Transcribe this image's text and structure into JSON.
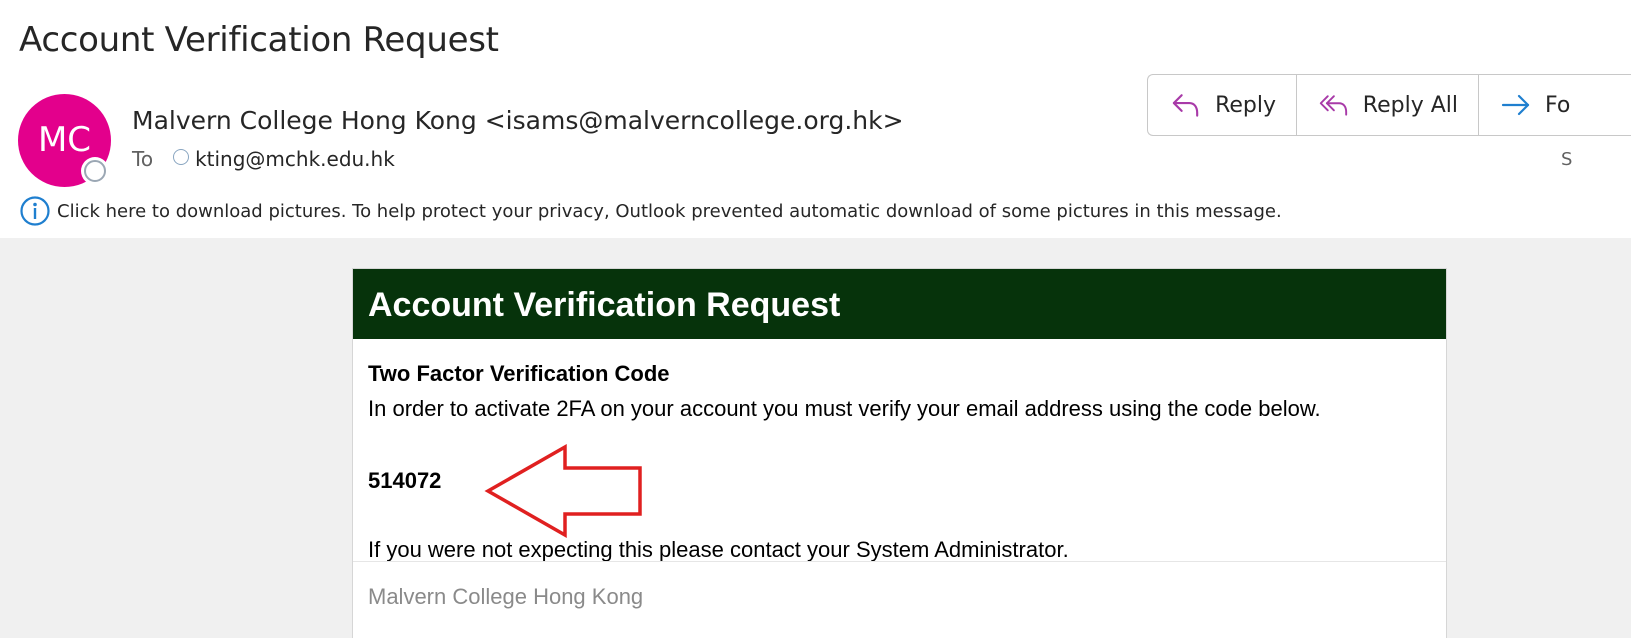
{
  "subject": "Account Verification Request",
  "avatar": {
    "initials": "MC",
    "color": "#e3008c"
  },
  "sender": {
    "display": "Malvern College Hong Kong <isams@malverncollege.org.hk>"
  },
  "recipients": {
    "label": "To",
    "address": "kting@mchk.edu.hk"
  },
  "actions": {
    "reply": "Reply",
    "reply_all": "Reply All",
    "forward_partial": "Fo"
  },
  "date_partial": "S",
  "infobar": {
    "text": "Click here to download pictures. To help protect your privacy, Outlook prevented automatic download of some pictures in this message.",
    "icon": "info-icon"
  },
  "email_body": {
    "header_title": "Account Verification Request",
    "header_bg": "#06330b",
    "code_title": "Two Factor Verification Code",
    "code_description": "In order to activate 2FA on your account you must verify your email address using the code below.",
    "code": "514072",
    "note": "If you were not expecting this please contact your System Administrator.",
    "footer": "Malvern College Hong Kong"
  },
  "annotation": {
    "icon": "red-arrow-annotation-icon",
    "color": "#e02020"
  }
}
